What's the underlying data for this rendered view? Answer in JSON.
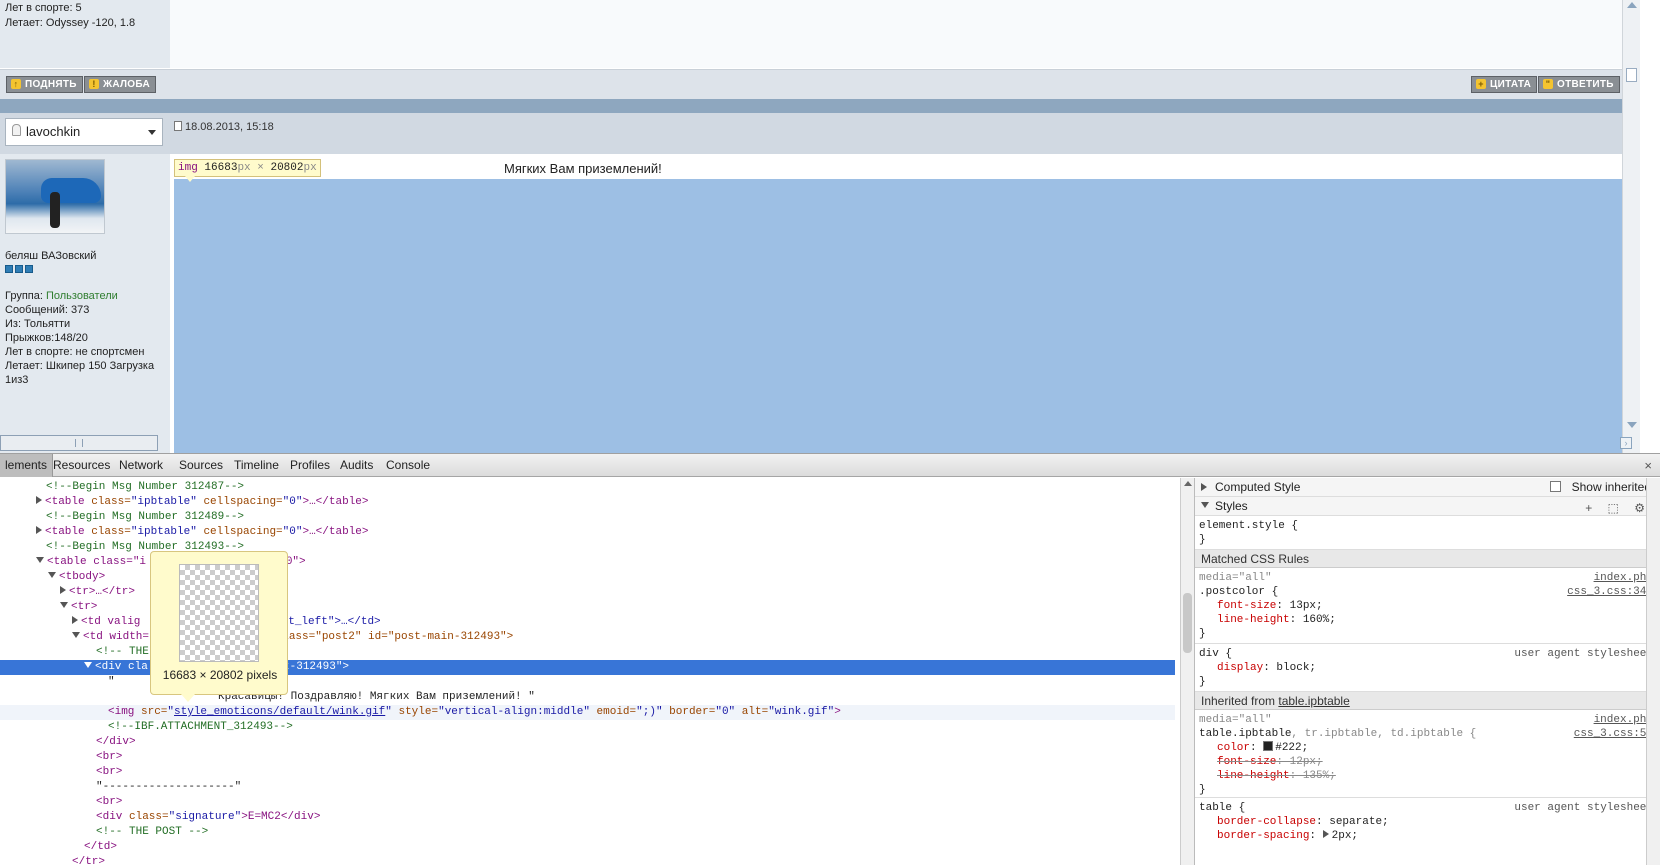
{
  "prev_post": {
    "sport_years": "Лет в спорте: 5",
    "flies": "Летает: Odyssey -120, 1.8"
  },
  "post_buttons": {
    "up": "ПОДНЯТЬ",
    "report": "ЖАЛОБА",
    "quote": "ЦИТАТА",
    "reply": "ОТВЕТИТЬ"
  },
  "post": {
    "username": "lavochkin",
    "date": "18.08.2013, 15:18",
    "text": "Мягких Вам приземлений!",
    "user_title": "беляш ВАЗовский",
    "group_label": "Группа: ",
    "group_value": "Пользователи",
    "messages": "Сообщений: 373",
    "from": "Из: Тольятти",
    "jumps": "Прыжков:148/20",
    "sport_years": "Лет в спорте: не спортсмен",
    "flies": "Летает: Шкипер 150 Загрузка",
    "flies2": "1из3"
  },
  "inspect_tooltip": {
    "tag": "img",
    "width": "16683",
    "height": "20802",
    "unit": "px",
    "times": "×"
  },
  "devtools": {
    "tabs": [
      "lements",
      "Resources",
      "Network",
      "Sources",
      "Timeline",
      "Profiles",
      "Audits",
      "Console"
    ],
    "close": "×",
    "image_preview_caption": "16683 × 20802 pixels",
    "computed_style": "Computed Style",
    "show_inherited": "Show inherited",
    "styles": "Styles",
    "matched_rules": "Matched CSS Rules",
    "inherited_from_label": "Inherited from ",
    "inherited_from_value": "table.ipbtable"
  },
  "dom": {
    "l1": "<!--Begin Msg Number 312487-->",
    "l2_tag": "<table",
    "l2_attr": " class=",
    "l2_val": "\"ipbtable\"",
    "l2_attr2": " cellspacing=",
    "l2_val2": "\"0\"",
    "l2_end": ">…</table>",
    "l3": "<!--Begin Msg Number 312489-->",
    "l5": "<!--Begin Msg Number 312493-->",
    "l6_a": "<table class=\"i",
    "l6_b": "g=\"0\">",
    "l7": "<tbody>",
    "l8": "<tr>…</tr>",
    "l9": "<tr>",
    "l10_a": "<td valig",
    "l10_b": "post_left\">…</td>",
    "l11_a": "<td width=",
    "l11_b": " class=\"post2\" id=\"post-main-312493\">",
    "l12": "<!-- THE",
    "l13_a": "<div cla",
    "l13_b": "ost-312493\">",
    "l14": "\"",
    "l15": "Красавицы! Поздравляю! Мягких Вам приземлений! \"",
    "l16_tag": "<img",
    "l16_src_attr": " src=",
    "l16_src": "style_emoticons/default/wink.gif",
    "l16_rest_attr1": " style=",
    "l16_rest_val1": "\"vertical-align:middle\"",
    "l16_rest_attr2": " emoid=",
    "l16_rest_val2": "\";)\"",
    "l16_rest_attr3": " border=",
    "l16_rest_val3": "\"0\"",
    "l16_rest_attr4": " alt=",
    "l16_rest_val4": "\"wink.gif\"",
    "l16_close": ">",
    "l17": "<!--IBF.ATTACHMENT_312493-->",
    "l18": "</div>",
    "l19": "<br>",
    "l20": "<br>",
    "l21": "\"--------------------\"",
    "l22": "<br>",
    "l23_tag": "<div",
    "l23_attr": " class=",
    "l23_val": "\"signature\"",
    "l23_text": ">E=MC2</div>",
    "l24": "<!-- THE POST -->",
    "l25": "</td>",
    "l26": "</tr>"
  },
  "css": {
    "element_style": "element.style {",
    "close": "}",
    "postcolor_media": "media=\"all\"",
    "postcolor_sel": ".postcolor {",
    "postcolor_src1": "index.php",
    "postcolor_src2": "css_3.css:344",
    "fs_name": "font-size",
    "fs_val": ": 13px;",
    "lh_name": "line-height",
    "lh_val": ": 160%;",
    "div_sel": "div {",
    "ua": "user agent stylesheet",
    "display_name": "display",
    "display_val": ": block;",
    "tbl_media": "media=\"all\"",
    "tbl_sel": "table.ipbtable",
    "tbl_sel_rest": ", tr.ipbtable, td.ipbtable {",
    "tbl_src1": "index.php",
    "tbl_src2": "css_3.css:55",
    "color_name": "color",
    "color_val": "#222;",
    "fs2_name": "font-size",
    "fs2_val": ": 12px;",
    "lh2_name": "line-height",
    "lh2_val": ": 135%;",
    "table_sel": "table {",
    "bc_name": "border-collapse",
    "bc_val": ": separate;",
    "bs_name": "border-spacing",
    "bs_val": "2px;"
  },
  "colors": {
    "selection": "#3875d7",
    "highlight": "#9dbfe4",
    "group": "#2f7d2f"
  }
}
